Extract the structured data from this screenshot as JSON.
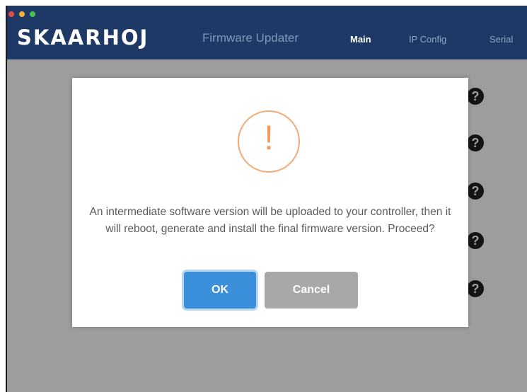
{
  "window": {
    "logo": "SKAARHOJ",
    "app_title": "Firmware Updater",
    "nav": {
      "main": "Main",
      "ip_config": "IP Config",
      "serial": "Serial"
    },
    "traffic_light_colors": {
      "close": "#e94b4b",
      "minimize": "#f0b43a",
      "maximize": "#4cc152"
    }
  },
  "background_help_icons": [
    "?",
    "?",
    "?",
    "?",
    "?"
  ],
  "dialog": {
    "icon": "warning-exclamation-icon",
    "icon_glyph": "!",
    "message": "An intermediate software version will be uploaded to your controller, then it will reboot, generate and install the final firmware version. Proceed?",
    "ok_label": "OK",
    "cancel_label": "Cancel"
  },
  "colors": {
    "header": "#1f3967",
    "overlay": "#9d9d9d",
    "primary_button": "#3b8fdb",
    "cancel_button": "#a8a8a8",
    "warning": "#f19a5c"
  }
}
